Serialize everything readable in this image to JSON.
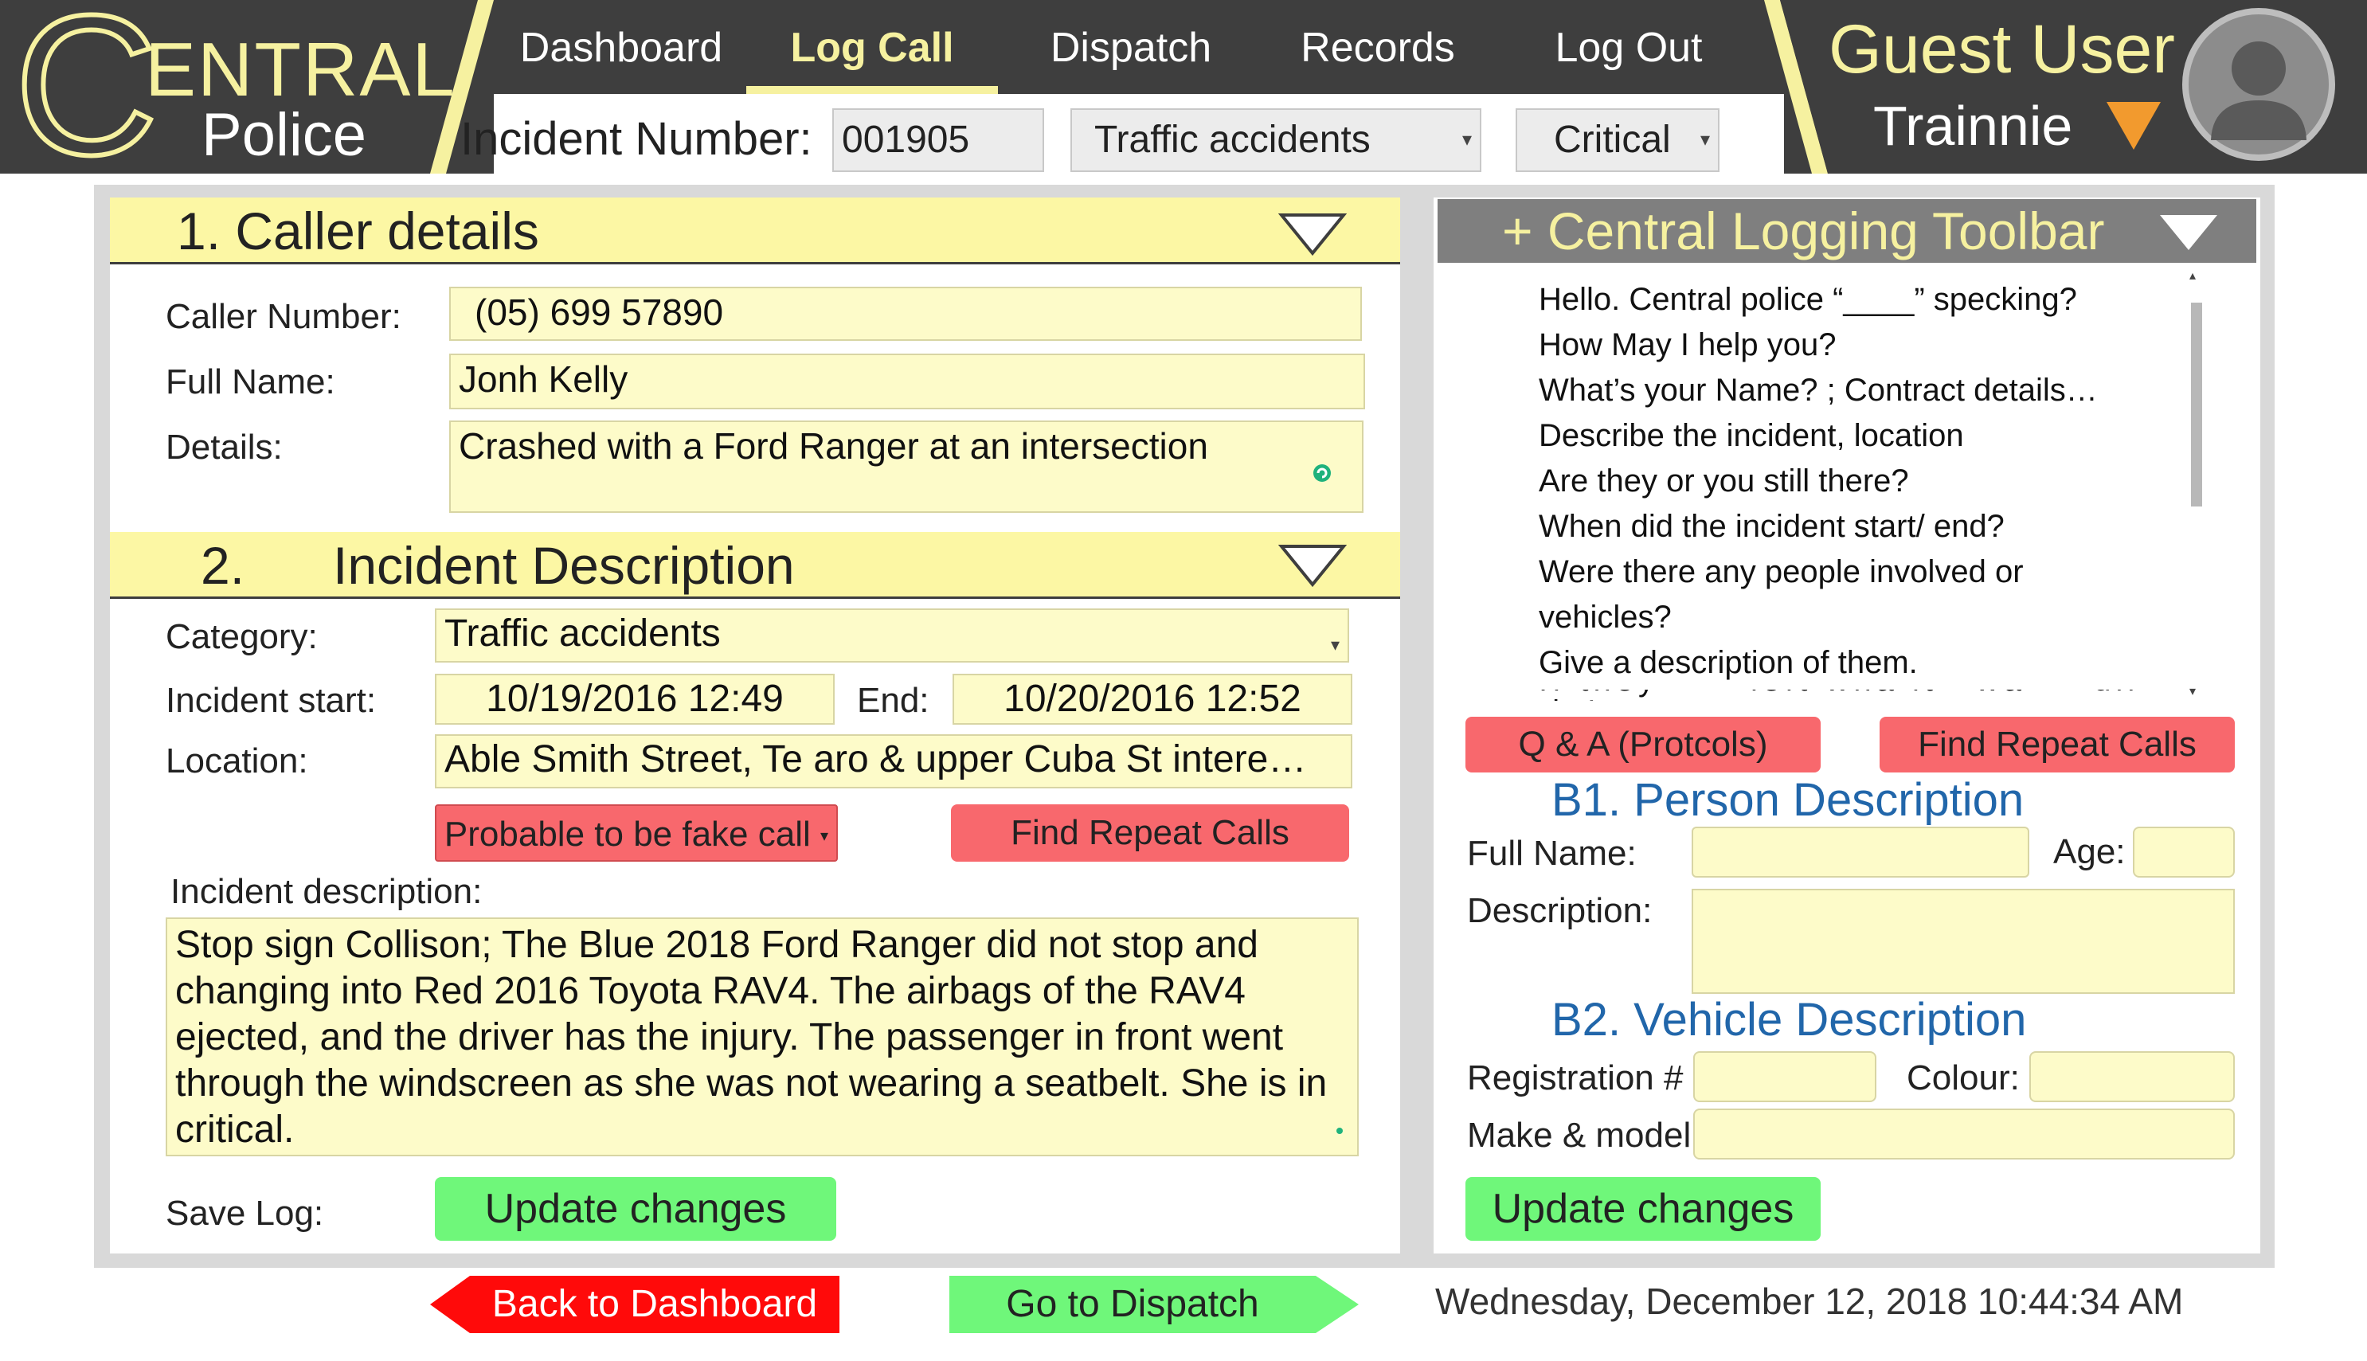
{
  "app": {
    "logo_initial": "C",
    "logo_rest": "ENTRAL",
    "logo_sub": "Police"
  },
  "nav": {
    "items": [
      "Dashboard",
      "Log Call",
      "Dispatch",
      "Records",
      "Log Out"
    ],
    "active": "Log Call"
  },
  "incident_bar": {
    "label": "Incident Number:",
    "number": "001905",
    "type": "Traffic accidents",
    "priority": "Critical"
  },
  "user": {
    "name": "Guest User",
    "role": "Trainnie"
  },
  "caller": {
    "section_title": "1. Caller details",
    "number_label": "Caller Number:",
    "number_value": "(05) 699 57890",
    "name_label": "Full Name:",
    "name_value": "Jonh Kelly",
    "details_label": "Details:",
    "details_value": "Crashed with a Ford Ranger at an intersection"
  },
  "incident": {
    "section_num": "2.",
    "section_title": "Incident Description",
    "category_label": "Category:",
    "category_value": "Traffic accidents",
    "start_label": "Incident start:",
    "start_value": "10/19/2016 12:49",
    "end_label": "End:",
    "end_value": "10/20/2016 12:52",
    "location_label": "Location:",
    "location_value": "Able Smith Street, Te aro & upper Cuba St intere…",
    "fake_call_label": "Probable to be fake call",
    "repeat_calls_label": "Find Repeat Calls",
    "description_label": "Incident description:",
    "description_value": "Stop sign Collison; The Blue 2018 Ford Ranger did not stop and changing into Red 2016 Toyota RAV4. The airbags of the RAV4 ejected, and the driver has the injury. The passenger in front went through the windscreen as she was not wearing a seatbelt. She is in critical.",
    "save_label": "Save Log:",
    "update_label": "Update changes"
  },
  "toolbar": {
    "title": "+ Central Logging Toolbar",
    "script": [
      "Hello. Central police “____” specking?",
      "How May I help you?",
      "What’s your Name? ; Contract details…",
      "Describe the incident, location",
      "Are they or you still there?",
      "When did the incident start/ end?",
      "Were there any people involved or",
      "vehicles?",
      "Give a description of them."
    ],
    "qa_label": "Q & A (Protcols)",
    "repeat_label": "Find Repeat Calls"
  },
  "person": {
    "heading": "B1. Person Description",
    "name_label": "Full Name:",
    "name_value": "",
    "age_label": "Age:",
    "age_value": "",
    "desc_label": "Description:",
    "desc_value": ""
  },
  "vehicle": {
    "heading": "B2. Vehicle Description",
    "reg_label": "Registration #",
    "reg_value": "",
    "colour_label": "Colour:",
    "colour_value": "",
    "make_label": "Make & model",
    "make_value": "",
    "update_label": "Update changes"
  },
  "footer": {
    "back_label": "Back to Dashboard",
    "dispatch_label": "Go to Dispatch",
    "datetime": "Wednesday, December 12, 2018 10:44:34 AM"
  },
  "colors": {
    "header_dark": "#3e3e3e",
    "brand_yellow": "#f6f1a0",
    "field_yellow": "#fdfbc9",
    "button_red": "#f8686d",
    "button_green": "#6ff77a",
    "heading_blue": "#2166aa"
  },
  "icons": {
    "section_collapse": "triangle-down-icon",
    "user_menu": "orange-triangle-down-icon",
    "avatar": "user-avatar-icon",
    "grammar": "grammar-check-icon"
  }
}
